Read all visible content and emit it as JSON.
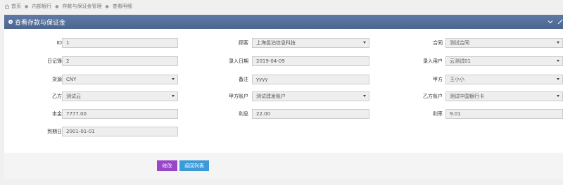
{
  "breadcrumb": {
    "items": [
      "首页",
      "内部银行",
      "存款与保证金管理",
      "查看明细"
    ]
  },
  "panel": {
    "title": "查看存款与保证金"
  },
  "fields": {
    "id": {
      "label": "ID",
      "value": "1"
    },
    "customer": {
      "label": "顾客",
      "value": "上海邑泊信息科技"
    },
    "contract": {
      "label": "合同",
      "value": "测试合同"
    },
    "journal": {
      "label": "日记簿",
      "value": "2"
    },
    "entry_date": {
      "label": "录入日期",
      "value": "2019-04-09"
    },
    "entry_user": {
      "label": "录入用户",
      "value": "云测试01"
    },
    "currency": {
      "label": "货源",
      "value": "CNY"
    },
    "remark": {
      "label": "备注",
      "value": "yyyy"
    },
    "party_a": {
      "label": "甲方",
      "value": "王小小"
    },
    "party_b": {
      "label": "乙方",
      "value": "测试云"
    },
    "party_a_account": {
      "label": "甲方账户",
      "value": "测试建发账户"
    },
    "party_b_account": {
      "label": "乙方账户",
      "value": "测试中国银行卡"
    },
    "principal": {
      "label": "本金",
      "value": "7777.00"
    },
    "interest": {
      "label": "利息",
      "value": "22.00"
    },
    "rate": {
      "label": "利率",
      "value": "9.01"
    },
    "due_date": {
      "label": "到期日",
      "value": "2001-01-01"
    }
  },
  "buttons": {
    "edit": "修改",
    "back": "返回列表"
  },
  "colors": {
    "header": "#4a6690",
    "edit_button": "#9847c9",
    "back_button": "#3c9ad9"
  }
}
